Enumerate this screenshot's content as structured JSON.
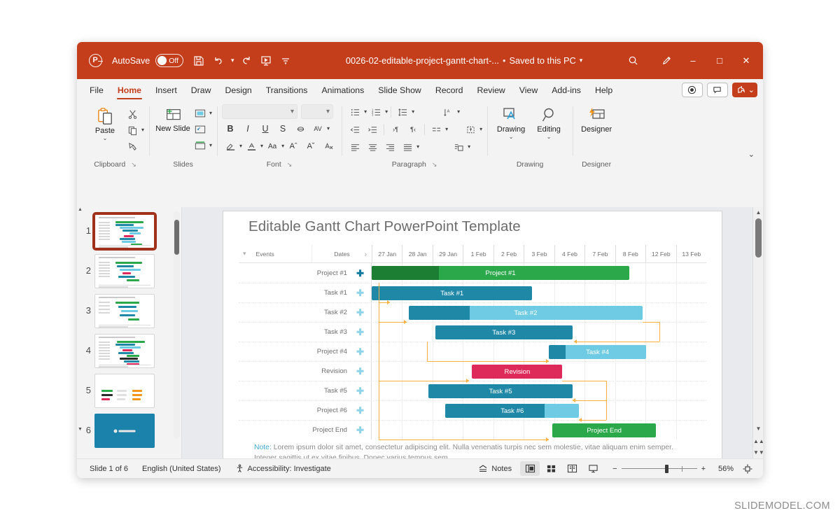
{
  "titlebar": {
    "app_icon": "powerpoint-logo-icon",
    "autosave_label": "AutoSave",
    "autosave_state": "Off",
    "quick_access": [
      {
        "name": "save-icon",
        "glyph": "💾"
      },
      {
        "name": "undo-icon",
        "glyph": "↶"
      },
      {
        "name": "redo-icon",
        "glyph": "↻"
      },
      {
        "name": "start-presentation-icon",
        "glyph": "⬜"
      },
      {
        "name": "customize-quick-access-icon",
        "glyph": "⌄"
      }
    ],
    "doc_name": "0026-02-editable-project-gantt-chart-...",
    "doc_sep": "•",
    "saved_state": "Saved to this PC",
    "search_icon": "search-icon",
    "pen_icon": "pen-icon",
    "minimize": "–",
    "maximize": "□",
    "close": "✕"
  },
  "ribbon": {
    "tabs": [
      {
        "label": "File",
        "active": false
      },
      {
        "label": "Home",
        "active": true
      },
      {
        "label": "Insert",
        "active": false
      },
      {
        "label": "Draw",
        "active": false
      },
      {
        "label": "Design",
        "active": false
      },
      {
        "label": "Transitions",
        "active": false
      },
      {
        "label": "Animations",
        "active": false
      },
      {
        "label": "Slide Show",
        "active": false
      },
      {
        "label": "Record",
        "active": false
      },
      {
        "label": "Review",
        "active": false
      },
      {
        "label": "View",
        "active": false
      },
      {
        "label": "Add-ins",
        "active": false
      },
      {
        "label": "Help",
        "active": false
      }
    ],
    "record_button": "record-icon",
    "comments_button": "comments-icon",
    "share_button": "share-icon",
    "share_caret": "⌄",
    "collapse_ribbon": "⌄",
    "groups": {
      "clipboard": {
        "label": "Clipboard",
        "paste_label": "Paste",
        "paste_caret": "⌄",
        "cut_icon": "scissors-icon",
        "copy_icon": "copy-icon",
        "format_painter_icon": "format-painter-icon",
        "dialog_launcher": "↘"
      },
      "slides": {
        "label": "Slides",
        "new_slide_label": "New Slide",
        "new_slide_caret": "⌄",
        "layout_icon": "layout-icon",
        "reset_icon": "reset-icon",
        "section_icon": "section-icon"
      },
      "font": {
        "label": "Font",
        "font_name_value": "",
        "font_size_value": "",
        "bold": "B",
        "italic": "I",
        "underline": "U",
        "strikethrough": "S",
        "text_shadow_icon": "text-shadow-icon",
        "char_spacing_icon": "character-spacing-icon",
        "text_highlight_icon": "text-highlight-icon",
        "font_color_icon": "font-color-icon",
        "change_case_label": "Aa",
        "increase_font": "A",
        "decrease_font": "A",
        "clear_formatting_icon": "clear-formatting-icon",
        "dialog_launcher": "↘"
      },
      "paragraph": {
        "label": "Paragraph",
        "dialog_launcher": "↘",
        "icons": [
          "bullets-icon",
          "numbering-icon",
          "line-spacing-icon",
          "text-direction-icon",
          "decrease-indent-icon",
          "increase-indent-icon",
          "ltr-icon",
          "rtl-icon",
          "columns-icon",
          "align-text-icon",
          "align-left-icon",
          "align-center-icon",
          "align-right-icon",
          "justify-icon",
          "convert-to-smartart-icon"
        ]
      },
      "drawing": {
        "label": "Drawing",
        "drawing_label": "Drawing",
        "drawing_caret": "⌄",
        "editing_label": "Editing",
        "editing_caret": "⌄"
      },
      "designer": {
        "label": "Designer",
        "designer_label": "Designer"
      }
    }
  },
  "thumbnails": [
    {
      "number": "1",
      "selected": true,
      "style": "gantt"
    },
    {
      "number": "2",
      "selected": false,
      "style": "gantt"
    },
    {
      "number": "3",
      "selected": false,
      "style": "gantt"
    },
    {
      "number": "4",
      "selected": false,
      "style": "gantt"
    },
    {
      "number": "5",
      "selected": false,
      "style": "blank"
    },
    {
      "number": "6",
      "selected": false,
      "style": "dark"
    }
  ],
  "slide": {
    "title": "Editable Gantt Chart PowerPoint Template",
    "note_lead": "Note:",
    "note_text": " Lorem ipsum dolor sit amet, consectetur adipiscing elit. Nulla venenatis turpis nec sem molestie, vitae aliquam enim semper. Integer sagittis ut ex vitae finibus. Donec varius tempus sem."
  },
  "chart_data": {
    "type": "bar",
    "subtype": "gantt",
    "title": "Editable Gantt Chart PowerPoint Template",
    "columns": {
      "collapse_icon": "chevron-down-icon",
      "events_header": "Events",
      "dates_header": "Dates",
      "expand_icon": "chevron-right-icon"
    },
    "timeline": [
      "27 Jan",
      "28 Jan",
      "29 Jan",
      "1 Feb",
      "2 Feb",
      "3 Feb",
      "4 Feb",
      "7 Feb",
      "8 Feb",
      "12 Feb",
      "13 Feb"
    ],
    "rows": [
      {
        "label": "Project #1",
        "add_icon": "add-icon",
        "add_active": true,
        "start": 0.0,
        "end": 0.77,
        "progress": 0.26,
        "fill": "#2aa84a",
        "progress_fill": "#1b7e33",
        "label_color": "#ffffff"
      },
      {
        "label": "Task #1",
        "add_icon": "add-icon",
        "add_active": false,
        "start": 0.0,
        "end": 0.48,
        "progress": 1.0,
        "fill": "#1f88a7",
        "progress_fill": "#1f88a7",
        "label_color": "#ffffff"
      },
      {
        "label": "Task #2",
        "add_icon": "add-icon",
        "add_active": false,
        "start": 0.11,
        "end": 0.81,
        "progress": 0.26,
        "fill": "#6ecbe3",
        "progress_fill": "#1f88a7",
        "label_color": "#ffffff"
      },
      {
        "label": "Task #3",
        "add_icon": "add-icon",
        "add_active": false,
        "start": 0.19,
        "end": 0.6,
        "progress": 1.0,
        "fill": "#1f88a7",
        "progress_fill": "#1f88a7",
        "label_color": "#ffffff"
      },
      {
        "label": "Project #4",
        "add_icon": "add-icon",
        "add_active": false,
        "start": 0.53,
        "end": 0.82,
        "progress": 0.17,
        "fill": "#6ecbe3",
        "progress_fill": "#1f88a7",
        "label_color": "#ffffff"
      },
      {
        "label": "Revision",
        "add_icon": "add-icon",
        "add_active": false,
        "start": 0.3,
        "end": 0.57,
        "progress": 1.0,
        "fill": "#e1२",
        "progress_fill": "#dd2a5a",
        "label_color": "#ffffff"
      },
      {
        "label": "Task #5",
        "add_icon": "add-icon",
        "add_active": false,
        "start": 0.17,
        "end": 0.6,
        "progress": 1.0,
        "fill": "#1f88a7",
        "progress_fill": "#1f88a7",
        "label_color": "#ffffff"
      },
      {
        "label": "Project #6",
        "add_icon": "add-icon",
        "add_active": false,
        "start": 0.22,
        "end": 0.62,
        "progress": 0.74,
        "fill": "#6ecbe3",
        "progress_fill": "#1f88a7",
        "label_color": "#ffffff"
      },
      {
        "label": "Project End",
        "add_icon": "add-icon",
        "add_active": false,
        "start": 0.54,
        "end": 0.85,
        "progress": 1.0,
        "fill": "#2aa84a",
        "progress_fill": "#2aa84a",
        "label_color": "#ffffff"
      }
    ],
    "bar_labels": [
      "Project #1",
      "Task #1",
      "Task #2",
      "Task #3",
      "Task #4",
      "Revision",
      "Task #5",
      "Task #6",
      "Project End"
    ],
    "colors": {
      "green": "#2aa84a",
      "green_dark": "#1b7e33",
      "teal": "#1f88a7",
      "teal_light": "#6ecbe3",
      "pink": "#dd2a5a",
      "connector": "#fbb040"
    },
    "grid": true,
    "legend_position": "none"
  },
  "statusbar": {
    "slide_counter": "Slide 1 of 6",
    "language": "English (United States)",
    "accessibility_icon": "accessibility-icon",
    "accessibility": "Accessibility: Investigate",
    "notes_icon": "notes-icon",
    "notes_label": "Notes",
    "views": [
      {
        "name": "normal-view-button",
        "active": true
      },
      {
        "name": "slide-sorter-button",
        "active": false
      },
      {
        "name": "reading-view-button",
        "active": false
      },
      {
        "name": "slideshow-button",
        "active": false
      }
    ],
    "zoom_out": "−",
    "zoom_in": "+",
    "zoom_value": "56%",
    "fit_slide_icon": "fit-to-window-icon"
  },
  "watermark": "SLIDEMODEL.COM"
}
